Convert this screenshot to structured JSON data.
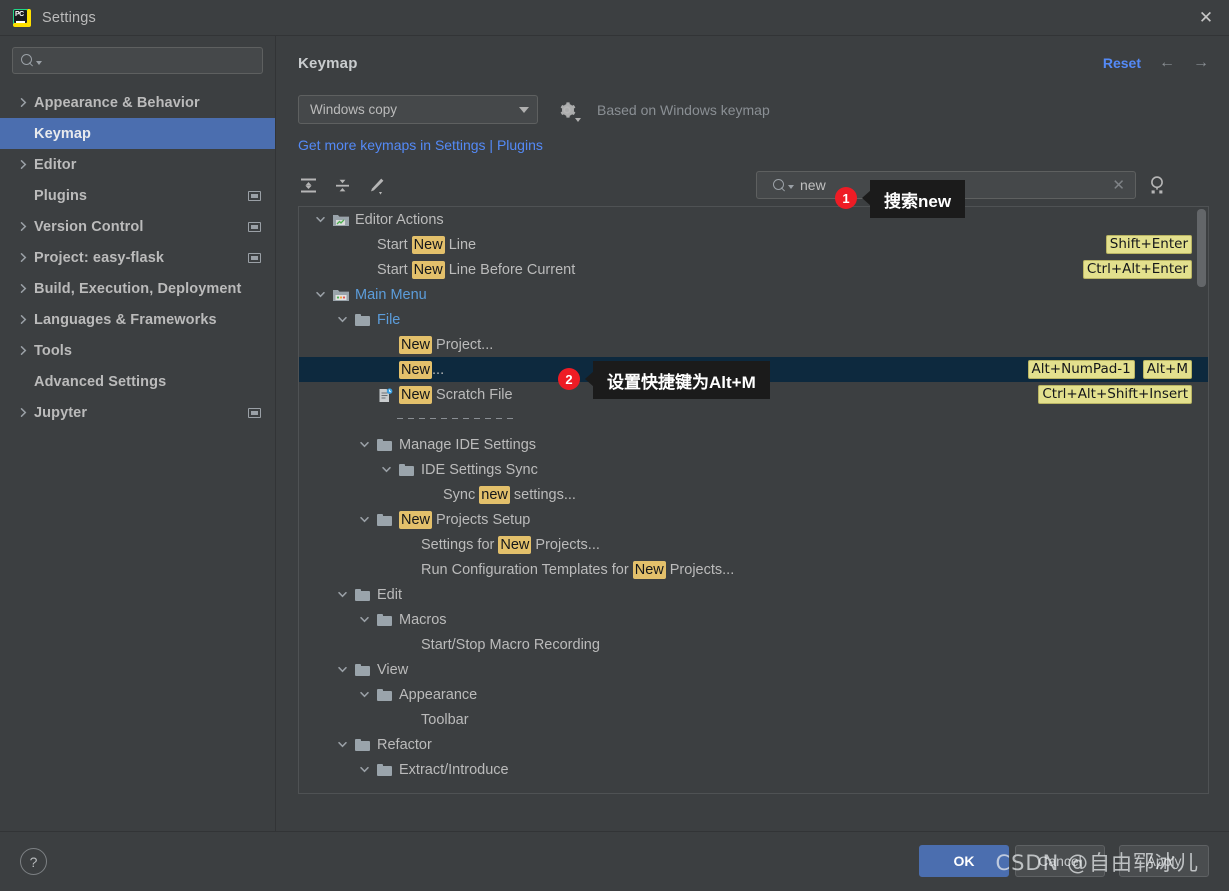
{
  "window": {
    "title": "Settings",
    "app_icon": "pycharm-icon",
    "close_label": "✕"
  },
  "sidebar": {
    "search": {
      "value": "",
      "placeholder": ""
    },
    "items": [
      {
        "label": "Appearance & Behavior",
        "arrow": true,
        "selected": false,
        "badge": false
      },
      {
        "label": "Keymap",
        "arrow": false,
        "selected": true,
        "badge": false
      },
      {
        "label": "Editor",
        "arrow": true,
        "selected": false,
        "badge": false
      },
      {
        "label": "Plugins",
        "arrow": false,
        "selected": false,
        "badge": true
      },
      {
        "label": "Version Control",
        "arrow": true,
        "selected": false,
        "badge": true
      },
      {
        "label": "Project: easy-flask",
        "arrow": true,
        "selected": false,
        "badge": true
      },
      {
        "label": "Build, Execution, Deployment",
        "arrow": true,
        "selected": false,
        "badge": false
      },
      {
        "label": "Languages & Frameworks",
        "arrow": true,
        "selected": false,
        "badge": false
      },
      {
        "label": "Tools",
        "arrow": true,
        "selected": false,
        "badge": false
      },
      {
        "label": "Advanced Settings",
        "arrow": false,
        "selected": false,
        "badge": false
      },
      {
        "label": "Jupyter",
        "arrow": true,
        "selected": false,
        "badge": true
      }
    ]
  },
  "content": {
    "page_title": "Keymap",
    "reset_label": "Reset",
    "back_arrow": "←",
    "forward_arrow": "→",
    "keymap_selected": "Windows copy",
    "based_on": "Based on Windows keymap",
    "more_keymaps_link": "Get more keymaps in Settings | Plugins",
    "toolbar": {
      "expand_all": "expand-all-icon",
      "collapse_all": "collapse-all-icon",
      "edit_shortcut": "edit-pencil-icon",
      "find_by_shortcut": "find-by-shortcut-icon"
    },
    "search": {
      "value": "new",
      "clear": "✕"
    }
  },
  "annotations": [
    {
      "number": "1",
      "text": "搜索new"
    },
    {
      "number": "2",
      "text": "设置快捷键为Alt+M"
    }
  ],
  "tree": {
    "rows": [
      {
        "id": "editor-actions",
        "indent": 0,
        "twisty": "down",
        "icon": "editor-actions-icon",
        "parts": [
          {
            "t": "Editor Actions",
            "hl": false
          }
        ],
        "color": "normal",
        "shortcuts": [],
        "selected": false
      },
      {
        "id": "start-new-line",
        "indent": 2,
        "twisty": "",
        "icon": "",
        "parts": [
          {
            "t": "Start ",
            "hl": false
          },
          {
            "t": "New",
            "hl": true
          },
          {
            "t": " Line",
            "hl": false
          }
        ],
        "color": "normal",
        "shortcuts": [
          "Shift+Enter"
        ],
        "selected": false
      },
      {
        "id": "start-new-line-before-current",
        "indent": 2,
        "twisty": "",
        "icon": "",
        "parts": [
          {
            "t": "Start ",
            "hl": false
          },
          {
            "t": "New",
            "hl": true
          },
          {
            "t": " Line Before Current",
            "hl": false
          }
        ],
        "color": "normal",
        "shortcuts": [
          "Ctrl+Alt+Enter"
        ],
        "selected": false
      },
      {
        "id": "main-menu",
        "indent": 0,
        "twisty": "down",
        "icon": "main-menu-icon",
        "parts": [
          {
            "t": "Main Menu",
            "hl": false
          }
        ],
        "color": "blue",
        "shortcuts": [],
        "selected": false
      },
      {
        "id": "file",
        "indent": 1,
        "twisty": "down",
        "icon": "folder",
        "parts": [
          {
            "t": "File",
            "hl": false
          }
        ],
        "color": "blue",
        "shortcuts": [],
        "selected": false
      },
      {
        "id": "new-project",
        "indent": 3,
        "twisty": "",
        "icon": "",
        "parts": [
          {
            "t": "New",
            "hl": true
          },
          {
            "t": " Project...",
            "hl": false
          }
        ],
        "color": "normal",
        "shortcuts": [],
        "selected": false
      },
      {
        "id": "new",
        "indent": 3,
        "twisty": "",
        "icon": "",
        "parts": [
          {
            "t": "New",
            "hl": true
          },
          {
            "t": "...",
            "hl": false
          }
        ],
        "color": "normal",
        "shortcuts": [
          "Alt+NumPad-1",
          "Alt+M"
        ],
        "selected": true
      },
      {
        "id": "new-scratch-file",
        "indent": 2,
        "twisty": "",
        "icon": "scratch-file-icon",
        "parts": [
          {
            "t": "New",
            "hl": true
          },
          {
            "t": " Scratch File",
            "hl": false
          }
        ],
        "color": "normal",
        "shortcuts": [
          "Ctrl+Alt+Shift+Insert"
        ],
        "selected": false
      },
      {
        "id": "separator",
        "indent": 3,
        "twisty": "",
        "icon": "",
        "parts": [],
        "color": "normal",
        "shortcuts": [],
        "selected": false,
        "separator": true
      },
      {
        "id": "manage-ide-settings",
        "indent": 2,
        "twisty": "down",
        "icon": "folder",
        "parts": [
          {
            "t": "Manage IDE Settings",
            "hl": false
          }
        ],
        "color": "normal",
        "shortcuts": [],
        "selected": false
      },
      {
        "id": "ide-settings-sync",
        "indent": 3,
        "twisty": "down",
        "icon": "folder",
        "parts": [
          {
            "t": "IDE Settings Sync",
            "hl": false
          }
        ],
        "color": "normal",
        "shortcuts": [],
        "selected": false
      },
      {
        "id": "sync-new-settings",
        "indent": 5,
        "twisty": "",
        "icon": "",
        "parts": [
          {
            "t": "Sync ",
            "hl": false
          },
          {
            "t": "new",
            "hl": true
          },
          {
            "t": " settings...",
            "hl": false
          }
        ],
        "color": "normal",
        "shortcuts": [],
        "selected": false
      },
      {
        "id": "new-projects-setup",
        "indent": 2,
        "twisty": "down",
        "icon": "folder",
        "parts": [
          {
            "t": "New",
            "hl": true
          },
          {
            "t": " Projects Setup",
            "hl": false
          }
        ],
        "color": "normal",
        "shortcuts": [],
        "selected": false
      },
      {
        "id": "settings-for-new-projects",
        "indent": 4,
        "twisty": "",
        "icon": "",
        "parts": [
          {
            "t": "Settings for ",
            "hl": false
          },
          {
            "t": "New",
            "hl": true
          },
          {
            "t": " Projects...",
            "hl": false
          }
        ],
        "color": "normal",
        "shortcuts": [],
        "selected": false
      },
      {
        "id": "run-configuration-templates",
        "indent": 4,
        "twisty": "",
        "icon": "",
        "parts": [
          {
            "t": "Run Configuration Templates for ",
            "hl": false
          },
          {
            "t": "New",
            "hl": true
          },
          {
            "t": " Projects...",
            "hl": false
          }
        ],
        "color": "normal",
        "shortcuts": [],
        "selected": false
      },
      {
        "id": "edit",
        "indent": 1,
        "twisty": "down",
        "icon": "folder",
        "parts": [
          {
            "t": "Edit",
            "hl": false
          }
        ],
        "color": "normal",
        "shortcuts": [],
        "selected": false
      },
      {
        "id": "macros",
        "indent": 2,
        "twisty": "down",
        "icon": "folder",
        "parts": [
          {
            "t": "Macros",
            "hl": false
          }
        ],
        "color": "normal",
        "shortcuts": [],
        "selected": false
      },
      {
        "id": "start-stop-macro-recording",
        "indent": 4,
        "twisty": "",
        "icon": "",
        "parts": [
          {
            "t": "Start/Stop Macro Recording",
            "hl": false
          }
        ],
        "color": "normal",
        "shortcuts": [],
        "selected": false
      },
      {
        "id": "view",
        "indent": 1,
        "twisty": "down",
        "icon": "folder",
        "parts": [
          {
            "t": "View",
            "hl": false
          }
        ],
        "color": "normal",
        "shortcuts": [],
        "selected": false
      },
      {
        "id": "appearance",
        "indent": 2,
        "twisty": "down",
        "icon": "folder",
        "parts": [
          {
            "t": "Appearance",
            "hl": false
          }
        ],
        "color": "normal",
        "shortcuts": [],
        "selected": false
      },
      {
        "id": "toolbar",
        "indent": 4,
        "twisty": "",
        "icon": "",
        "parts": [
          {
            "t": "Toolbar",
            "hl": false
          }
        ],
        "color": "normal",
        "shortcuts": [],
        "selected": false
      },
      {
        "id": "refactor",
        "indent": 1,
        "twisty": "down",
        "icon": "folder",
        "parts": [
          {
            "t": "Refactor",
            "hl": false
          }
        ],
        "color": "normal",
        "shortcuts": [],
        "selected": false
      },
      {
        "id": "extract-introduce",
        "indent": 2,
        "twisty": "down",
        "icon": "folder",
        "parts": [
          {
            "t": "Extract/Introduce",
            "hl": false
          }
        ],
        "color": "normal",
        "shortcuts": [],
        "selected": false
      }
    ]
  },
  "footer": {
    "help": "?",
    "ok": "OK",
    "cancel": "Cancel",
    "apply": "Apply"
  },
  "watermark": "CSDN @自由郓冰儿",
  "colors": {
    "accent_blue": "#4b6eaf",
    "link_blue": "#548af7",
    "highlight_yellow": "#e3c06b",
    "shortcut_yellow": "#e3e08d",
    "badge_red": "#ee1c25",
    "selected_row": "#0d293e",
    "background": "#3c3f41"
  }
}
